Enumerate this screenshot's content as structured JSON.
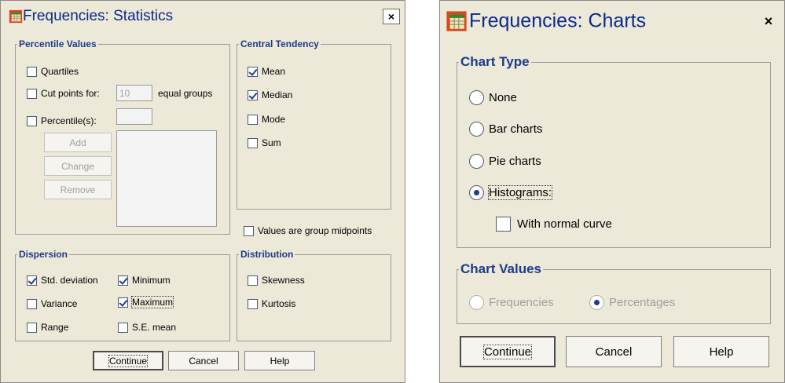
{
  "stats_dialog": {
    "title": "Frequencies: Statistics",
    "close_label": "×",
    "percentile": {
      "legend": "Percentile Values",
      "quartiles": {
        "label": "Quartiles",
        "checked": false
      },
      "cut_points": {
        "label": "Cut points for:",
        "checked": false,
        "value": "10",
        "suffix": "equal groups"
      },
      "percentiles": {
        "label": "Percentile(s):",
        "checked": false,
        "value": ""
      },
      "add_label": "Add",
      "change_label": "Change",
      "remove_label": "Remove"
    },
    "central": {
      "legend": "Central Tendency",
      "mean": {
        "label": "Mean",
        "checked": true
      },
      "median": {
        "label": "Median",
        "checked": true
      },
      "mode": {
        "label": "Mode",
        "checked": false
      },
      "sum": {
        "label": "Sum",
        "checked": false
      }
    },
    "midpoints": {
      "label": "Values are group midpoints",
      "checked": false
    },
    "dispersion": {
      "legend": "Dispersion",
      "std_dev": {
        "label": "Std. deviation",
        "checked": true
      },
      "variance": {
        "label": "Variance",
        "checked": false
      },
      "range": {
        "label": "Range",
        "checked": false
      },
      "minimum": {
        "label": "Minimum",
        "checked": true
      },
      "maximum": {
        "label": "Maximum",
        "checked": true
      },
      "se_mean": {
        "label": "S.E. mean",
        "checked": false
      }
    },
    "distribution": {
      "legend": "Distribution",
      "skewness": {
        "label": "Skewness",
        "checked": false
      },
      "kurtosis": {
        "label": "Kurtosis",
        "checked": false
      }
    },
    "buttons": {
      "continue": "Continue",
      "cancel": "Cancel",
      "help": "Help"
    }
  },
  "charts_dialog": {
    "title": "Frequencies: Charts",
    "close_label": "×",
    "chart_type": {
      "legend": "Chart Type",
      "none": {
        "label": "None",
        "selected": false
      },
      "bar": {
        "label": "Bar charts",
        "selected": false
      },
      "pie": {
        "label": "Pie charts",
        "selected": false
      },
      "histograms": {
        "label": "Histograms:",
        "selected": true
      },
      "normal_curve": {
        "label": "With normal curve",
        "checked": false
      }
    },
    "chart_values": {
      "legend": "Chart Values",
      "frequencies": {
        "label": "Frequencies",
        "selected": false
      },
      "percentages": {
        "label": "Percentages",
        "selected": true
      }
    },
    "buttons": {
      "continue": "Continue",
      "cancel": "Cancel",
      "help": "Help"
    }
  },
  "colors": {
    "dialog_bg": "#ece9d8",
    "legend_text": "#1c3b8a",
    "title_text": "#0b2a8a",
    "check_mark": "#1f3d8f",
    "disabled_text": "#a0a0a0"
  },
  "icons": {
    "app_icon": "spss-table-icon",
    "close": "close-icon"
  }
}
